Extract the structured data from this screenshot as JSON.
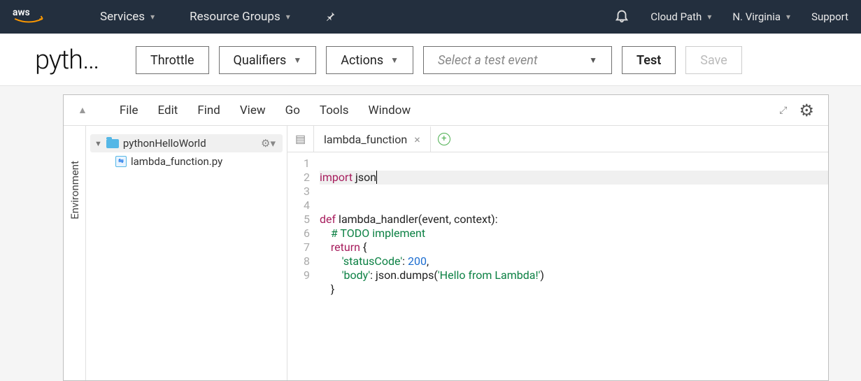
{
  "nav": {
    "services": "Services",
    "resource_groups": "Resource Groups",
    "account": "Cloud Path",
    "region": "N. Virginia",
    "support": "Support"
  },
  "actionbar": {
    "function_name": "pyth…",
    "throttle": "Throttle",
    "qualifiers": "Qualifiers",
    "actions": "Actions",
    "select_test_placeholder": "Select a test event",
    "test": "Test",
    "save": "Save"
  },
  "ide": {
    "menu": [
      "File",
      "Edit",
      "Find",
      "View",
      "Go",
      "Tools",
      "Window"
    ],
    "env_rail": "Environment",
    "tree": {
      "folder": "pythonHelloWorld",
      "file": "lambda_function.py"
    },
    "tab": "lambda_function",
    "code": {
      "lines": [
        "1",
        "2",
        "3",
        "4",
        "5",
        "6",
        "7",
        "8",
        "9"
      ],
      "l1_kw": "import",
      "l1_mod": " json",
      "l3_kw": "def",
      "l3_sig": " lambda_handler(event, context):",
      "l4_cm": "    # TODO implement",
      "l5_kw": "    return",
      "l5_rest": " {",
      "l6_key": "        'statusCode'",
      "l6_colon": ": ",
      "l6_val": "200",
      "l6_comma": ",",
      "l7_key": "        'body'",
      "l7_colon": ": json.dumps(",
      "l7_str": "'Hello from Lambda!'",
      "l7_close": ")",
      "l8": "    }"
    }
  }
}
